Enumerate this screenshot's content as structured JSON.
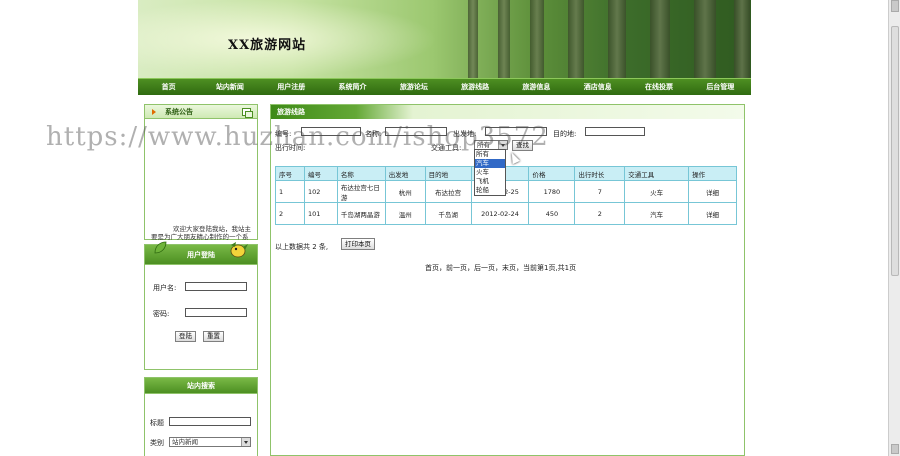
{
  "site_title": "XX旅游网站",
  "nav": [
    "首页",
    "站内新闻",
    "用户注册",
    "系统简介",
    "旅游论坛",
    "旅游线路",
    "旅游信息",
    "酒店信息",
    "在线投票",
    "后台管理"
  ],
  "notice": {
    "title": "系统公告",
    "text": "欢迎大家登陆我站，我站主要是为广大朋友精心制作的一个系统，希望大家能够"
  },
  "login": {
    "title": "用户登陆",
    "username_label": "用户名:",
    "password_label": "密码:",
    "login_btn": "登陆",
    "reset_btn": "重置"
  },
  "site_search": {
    "title": "站内搜索",
    "title_label": "标题",
    "category_label": "类别",
    "category_value": "站内新闻"
  },
  "main": {
    "title": "旅游线路",
    "filters": {
      "code_label": "编号:",
      "name_label": "名称:",
      "origin_label": "出发地:",
      "dest_label": "目的地:",
      "date_label": "出行时间:",
      "transport_label": "交通工具:",
      "transport_value": "所有",
      "search_btn": "查找"
    },
    "transport_options": [
      "所有",
      "汽车",
      "火车",
      "飞机",
      "轮船"
    ],
    "columns": [
      "序号",
      "编号",
      "名称",
      "出发地",
      "目的地",
      "出行时间",
      "价格",
      "出行时长",
      "交通工具",
      "操作"
    ],
    "rows": [
      {
        "idx": "1",
        "code": "102",
        "name": "布达拉宫七日游",
        "from": "杭州",
        "to": "布达拉宫",
        "date": "2012-02-25",
        "price": "1780",
        "days": "7",
        "transport": "火车",
        "op": "详细"
      },
      {
        "idx": "2",
        "code": "101",
        "name": "千岛湖两晶游",
        "from": "温州",
        "to": "千岛湖",
        "date": "2012-02-24",
        "price": "450",
        "days": "2",
        "transport": "汽车",
        "op": "详细"
      }
    ],
    "total_text": "以上数据共 2 条,",
    "print_btn": "打印本页",
    "pager": "首页，前一页，后一页，末页，当前第1页,共1页"
  },
  "watermark": "https://www.huzhan.com/ishop3572"
}
